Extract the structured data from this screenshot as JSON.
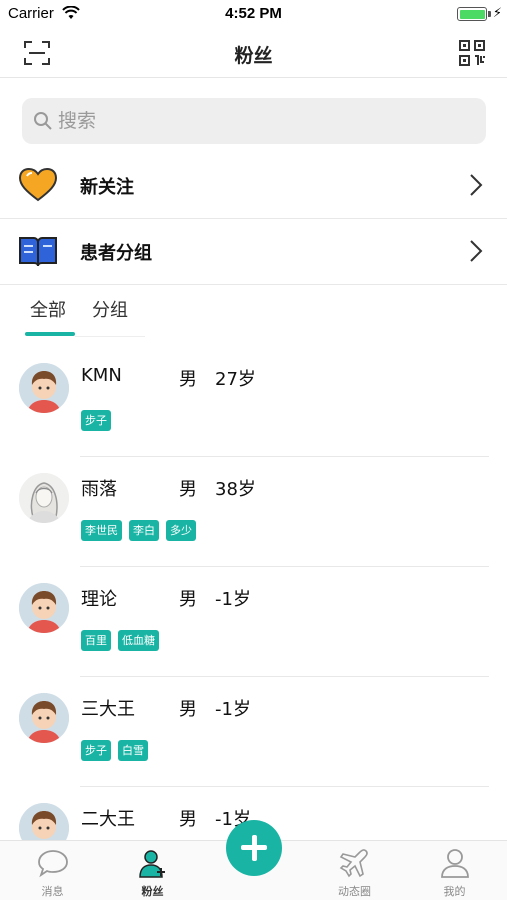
{
  "status_bar": {
    "carrier": "Carrier",
    "time": "4:52 PM"
  },
  "nav": {
    "title": "粉丝",
    "left_icon": "scan-icon",
    "right_icon": "qr-code-icon"
  },
  "search": {
    "placeholder": "搜索",
    "value": ""
  },
  "menu": [
    {
      "label": "新关注",
      "icon": "heart-icon"
    },
    {
      "label": "患者分组",
      "icon": "book-icon"
    }
  ],
  "tabs": [
    {
      "label": "全部",
      "active": true
    },
    {
      "label": "分组",
      "active": false
    }
  ],
  "patients": [
    {
      "name": "KMN",
      "gender": "男",
      "age": "27岁",
      "tags": [
        "步子"
      ]
    },
    {
      "name": "雨落",
      "gender": "男",
      "age": "38岁",
      "tags": [
        "李世民",
        "李白",
        "多少"
      ]
    },
    {
      "name": "理论",
      "gender": "男",
      "age": "-1岁",
      "tags": [
        "百里",
        "低血糖"
      ]
    },
    {
      "name": "三大王",
      "gender": "男",
      "age": "-1岁",
      "tags": [
        "步子",
        "白雪"
      ]
    },
    {
      "name": "二大王",
      "gender": "男",
      "age": "-1岁",
      "tags": []
    }
  ],
  "tab_bar": {
    "items": [
      {
        "label": "消息",
        "icon": "chat-bubble-icon",
        "active": false
      },
      {
        "label": "粉丝",
        "icon": "fans-person-icon",
        "active": true
      },
      {
        "label": "动态圈",
        "icon": "plane-icon",
        "active": false
      },
      {
        "label": "我的",
        "icon": "profile-icon",
        "active": false
      }
    ],
    "center_action_icon": "plus-icon"
  },
  "colors": {
    "accent": "#1ab4a4",
    "heart": "#f5a623",
    "book": "#2f63d9"
  }
}
